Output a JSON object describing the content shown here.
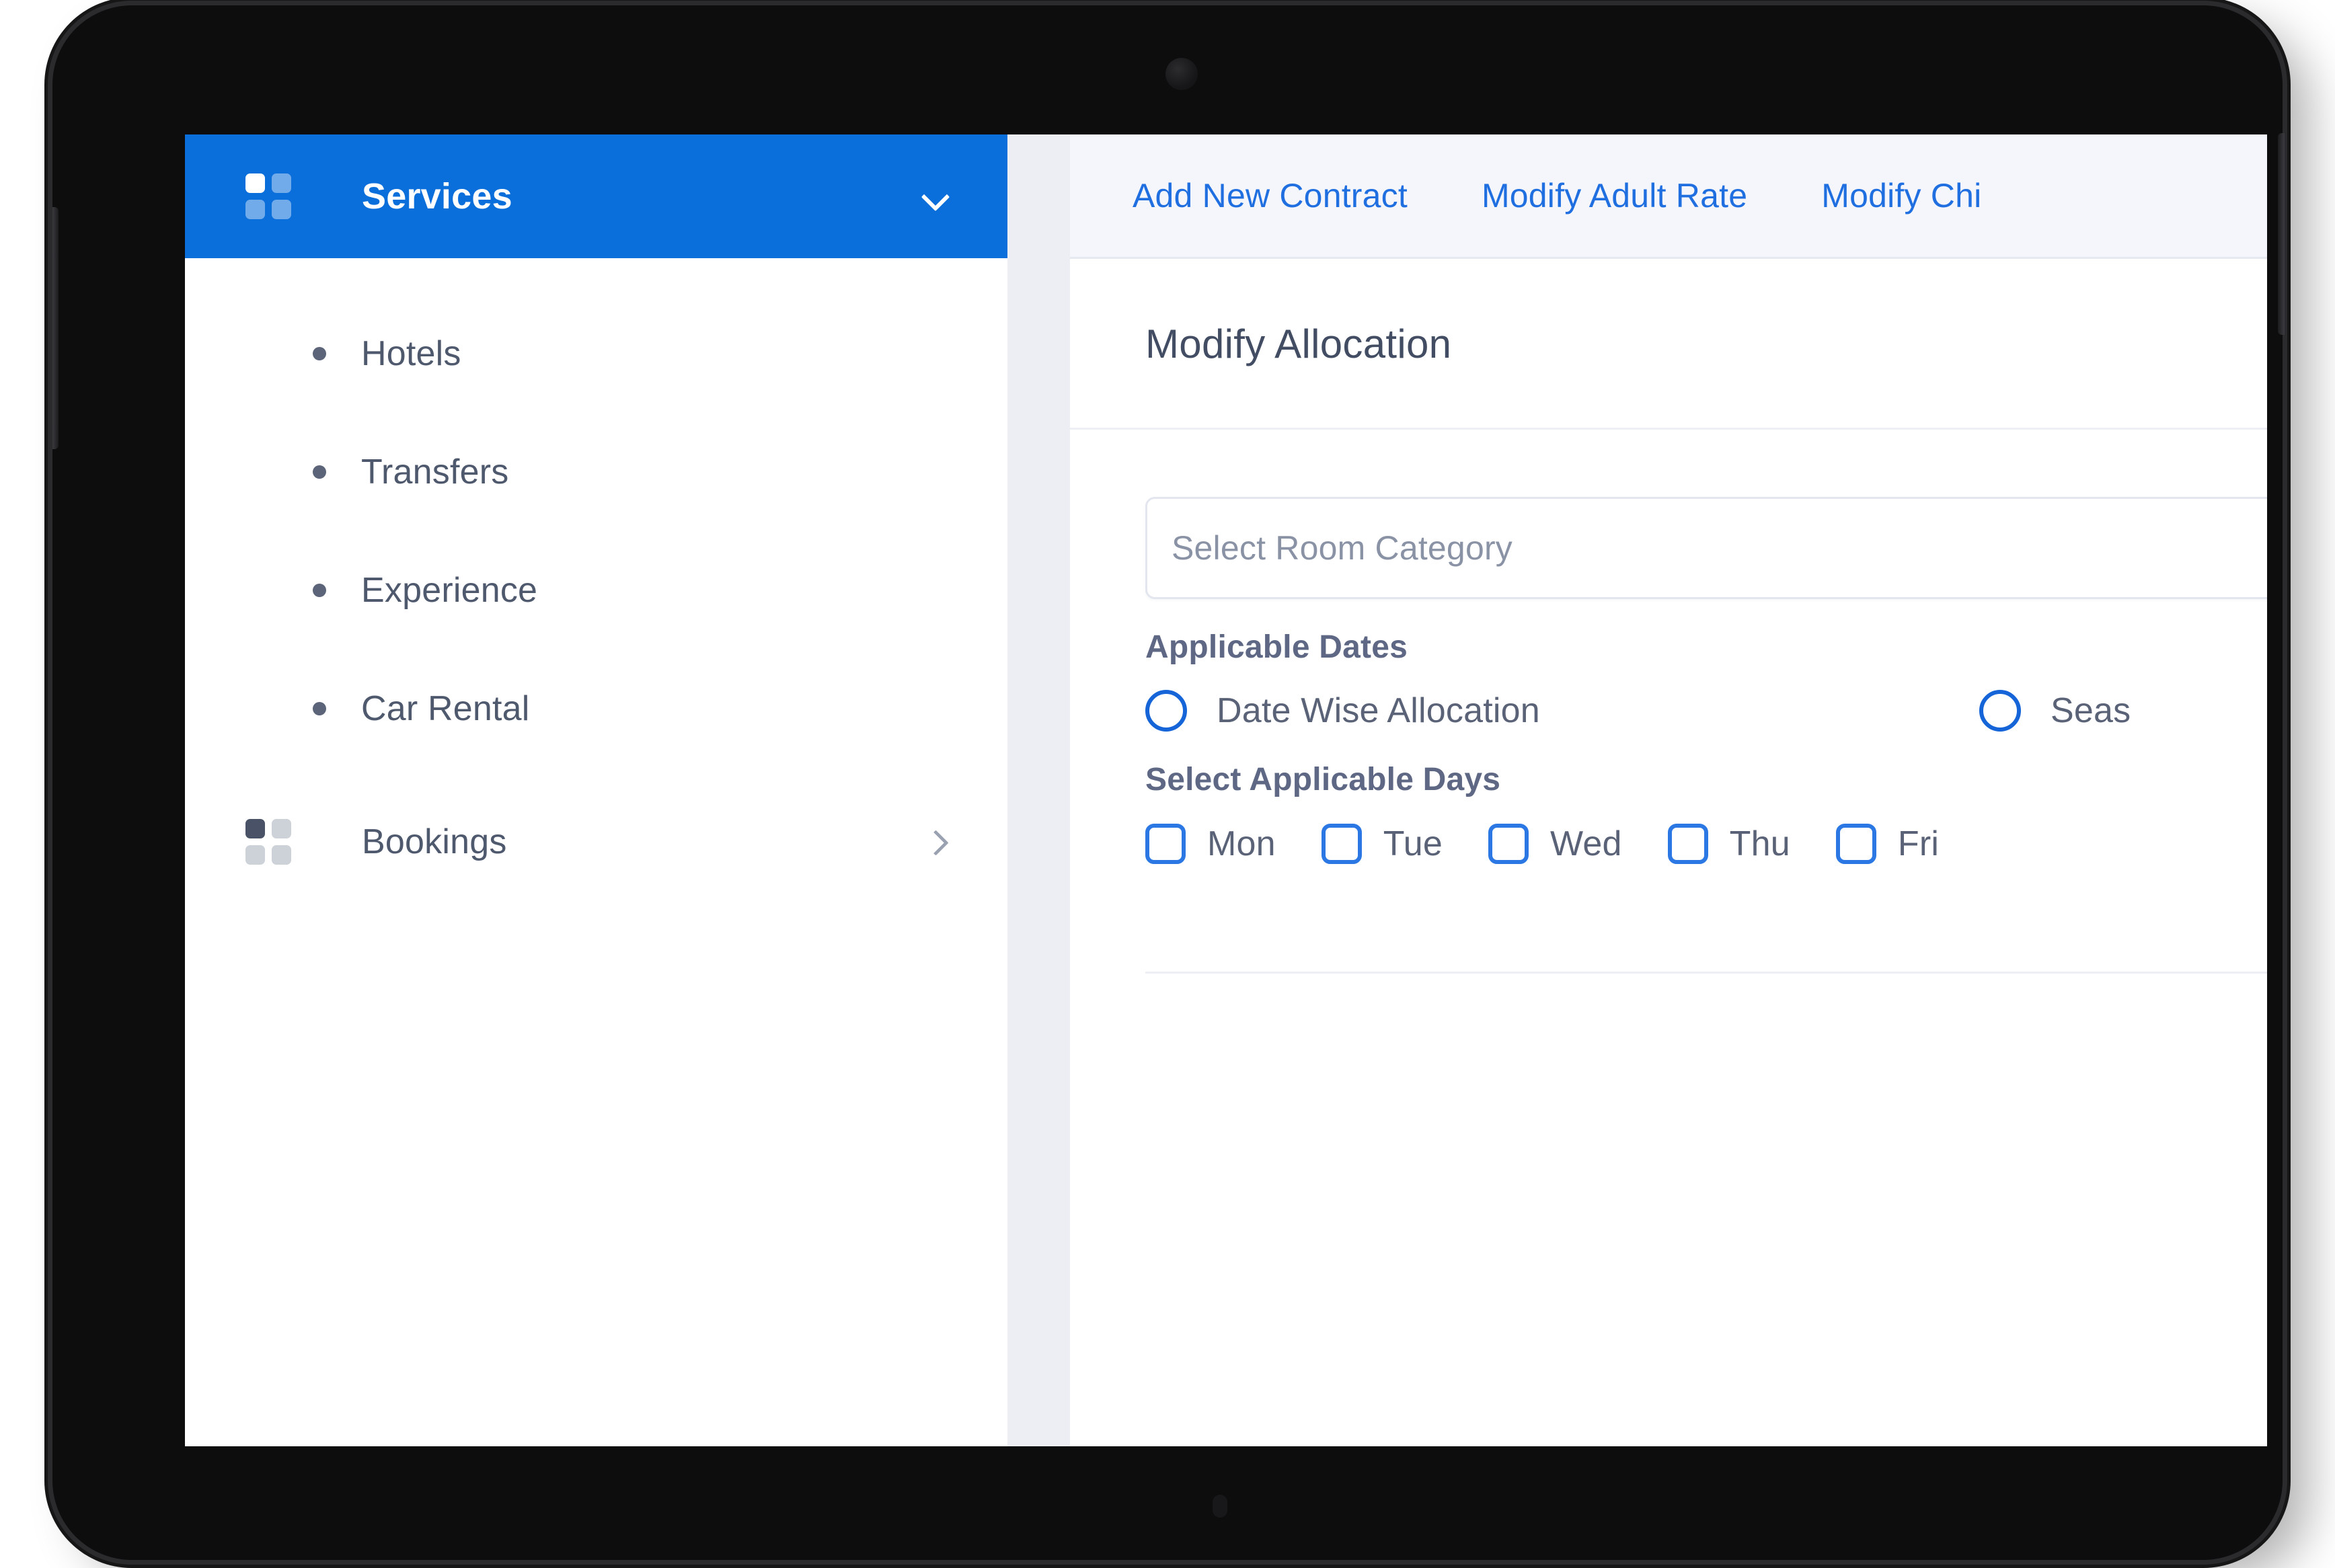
{
  "sidebar": {
    "header": {
      "title": "Services",
      "icon": "grid-2x2-icon",
      "chevron": "chevron-down-icon",
      "accent_color": "#0b6fdb"
    },
    "sub_items": [
      {
        "label": "Hotels"
      },
      {
        "label": "Transfers"
      },
      {
        "label": "Experience"
      },
      {
        "label": "Car Rental"
      }
    ],
    "nav_items": [
      {
        "label": "Bookings",
        "icon": "grid-2x2-icon",
        "chevron": "chevron-right-icon"
      }
    ]
  },
  "content": {
    "tabs": [
      {
        "label": "Add New Contract"
      },
      {
        "label": "Modify Adult Rate"
      },
      {
        "label": "Modify Chi"
      }
    ],
    "panel": {
      "title": "Modify Allocation",
      "room_category": {
        "placeholder": "Select Room Category",
        "value": ""
      },
      "applicable_dates": {
        "label": "Applicable Dates",
        "options": [
          {
            "label": "Date Wise Allocation",
            "selected": false
          },
          {
            "label": "Seas",
            "selected": false
          }
        ]
      },
      "applicable_days": {
        "label": "Select Applicable Days",
        "days": [
          {
            "label": "Mon",
            "checked": false
          },
          {
            "label": "Tue",
            "checked": false
          },
          {
            "label": "Wed",
            "checked": false
          },
          {
            "label": "Thu",
            "checked": false
          },
          {
            "label": "Fri",
            "checked": false
          }
        ]
      }
    }
  },
  "theme": {
    "brand_blue": "#0b6fdb",
    "link_blue": "#1f6fe0",
    "control_blue": "#1565d8",
    "text_slate": "#4f596e",
    "label_slate": "#5e6885",
    "placeholder_gray": "#8a93a6"
  }
}
